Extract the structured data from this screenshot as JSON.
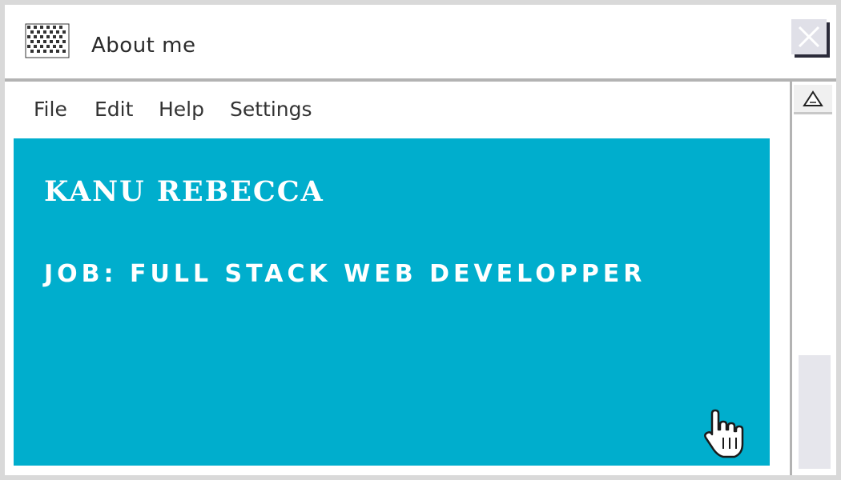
{
  "window": {
    "title": "About me",
    "icons": {
      "app": "app-icon",
      "close": "close-icon"
    }
  },
  "menu": [
    {
      "label": "File"
    },
    {
      "label": "Edit"
    },
    {
      "label": "Help"
    },
    {
      "label": "Settings"
    }
  ],
  "content": {
    "name": "KANU REBECCA",
    "job": "JOB: FULL STACK WEB DEVELOPPER",
    "panel_color": "#00aecd"
  },
  "scrollbar": {
    "icons": {
      "up": "triangle-up-icon"
    }
  },
  "cursor": {
    "icon": "hand-pointer-icon"
  }
}
